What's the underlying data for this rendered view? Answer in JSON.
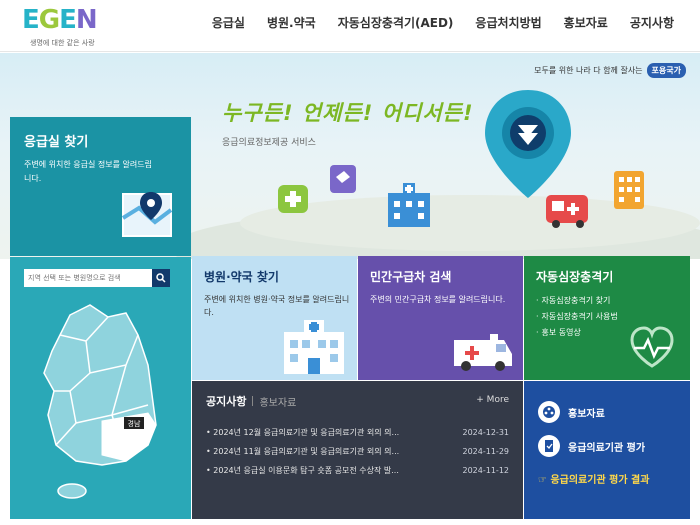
{
  "header": {
    "logo_letters": [
      "E",
      "G",
      "E",
      "N"
    ],
    "logo_tagline": "생명에 대한 같은 사랑",
    "nav": [
      "응급실",
      "병원.약국",
      "자동심장충격기(AED)",
      "응급처치방법",
      "홍보자료",
      "공지사항"
    ]
  },
  "hero": {
    "slogan": "모두를 위한 나라 다 함께 잘사는",
    "slogan_badge": "포용국가",
    "title": "누구든! 언제든! 어디서든!",
    "subtitle": "응급의료정보제공 서비스"
  },
  "er_finder": {
    "title": "응급실 찾기",
    "desc": "주변에 위치한 응급실 정보를 알려드립니다.",
    "search_placeholder": "지역 선택 또는 병원명으로 검색",
    "region_label": "경남"
  },
  "cards": {
    "hospital": {
      "title": "병원·약국 찾기",
      "desc": "주변에 위치한 병원·약국 정보를 알려드립니다."
    },
    "ambulance": {
      "title": "민간구급차 검색",
      "desc": "주변의 민간구급차 정보를 알려드립니다."
    },
    "aed": {
      "title": "자동심장충격기",
      "items": [
        "자동심장충격기 찾기",
        "자동심장충격기 사용법",
        "홍보 동영상"
      ]
    }
  },
  "notice": {
    "tab_active": "공지사항",
    "tab_other": "홍보자료",
    "more": "+ More",
    "rows": [
      {
        "title": "2024년 12월 응급의료기관 및 응급의료기관 외의 의...",
        "date": "2024-12-31"
      },
      {
        "title": "2024년 11월 응급의료기관 및 응급의료기관 외의 의...",
        "date": "2024-11-29"
      },
      {
        "title": "2024년 응급실 이용문화 탐구 숏폼 공모전 수상작 발...",
        "date": "2024-11-12"
      }
    ]
  },
  "quick": {
    "items": [
      "홍보자료",
      "응급의료기관 평가"
    ],
    "link": "응급의료기관 평가 결과"
  },
  "colors": {
    "teal": "#1b93a4",
    "map": "#2aa8b7",
    "light_blue": "#bfe0f3",
    "purple": "#6650ab",
    "green": "#1e8a45",
    "dark": "#343a48",
    "blue": "#1e4fa0",
    "accent_yellow": "#ffd84a"
  }
}
